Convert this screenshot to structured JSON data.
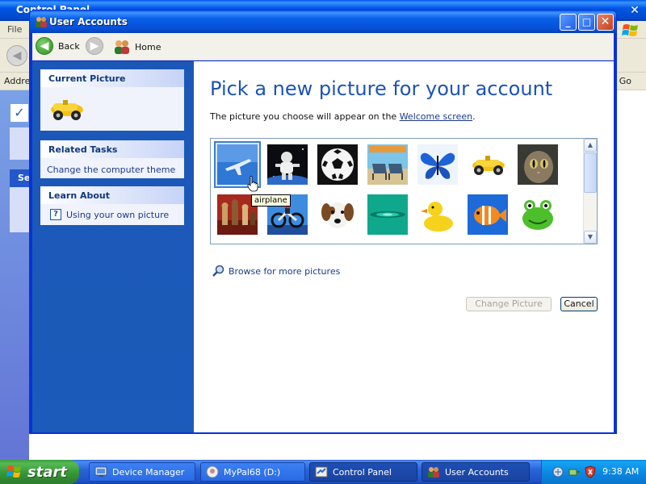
{
  "background_window": {
    "title": "Control Panel",
    "menu_file": "File",
    "address_label": "Address",
    "go_label": "Go",
    "task_heading_fragment": "Se"
  },
  "window": {
    "title": "User Accounts",
    "minimize": "_",
    "maximize": "□",
    "close": "✕"
  },
  "nav": {
    "back_label": "Back",
    "home_label": "Home"
  },
  "sidebar": {
    "current_picture_heading": "Current Picture",
    "related_tasks_heading": "Related Tasks",
    "related_task_link": "Change the computer theme",
    "learn_about_heading": "Learn About",
    "learn_about_link": "Using your own picture"
  },
  "main": {
    "title": "Pick a new picture for your account",
    "description_prefix": "The picture you choose will appear on the ",
    "description_link": "Welcome screen",
    "description_suffix": ".",
    "tooltip": "airplane",
    "browse_label": "Browse for more pictures",
    "change_button": "Change Picture",
    "cancel_button": "Cancel",
    "pictures": [
      "airplane",
      "astronaut",
      "soccer ball",
      "beach chairs",
      "butterfly",
      "race car",
      "cat",
      "chess",
      "dirt bike",
      "dog",
      "fish",
      "duck",
      "horses",
      "frog"
    ]
  },
  "taskbar": {
    "start_label": "start",
    "items": [
      {
        "label": "Device Manager"
      },
      {
        "label": "MyPal68 (D:)"
      },
      {
        "label": "Control Panel"
      },
      {
        "label": "User Accounts"
      }
    ],
    "clock": "9:38 AM"
  }
}
